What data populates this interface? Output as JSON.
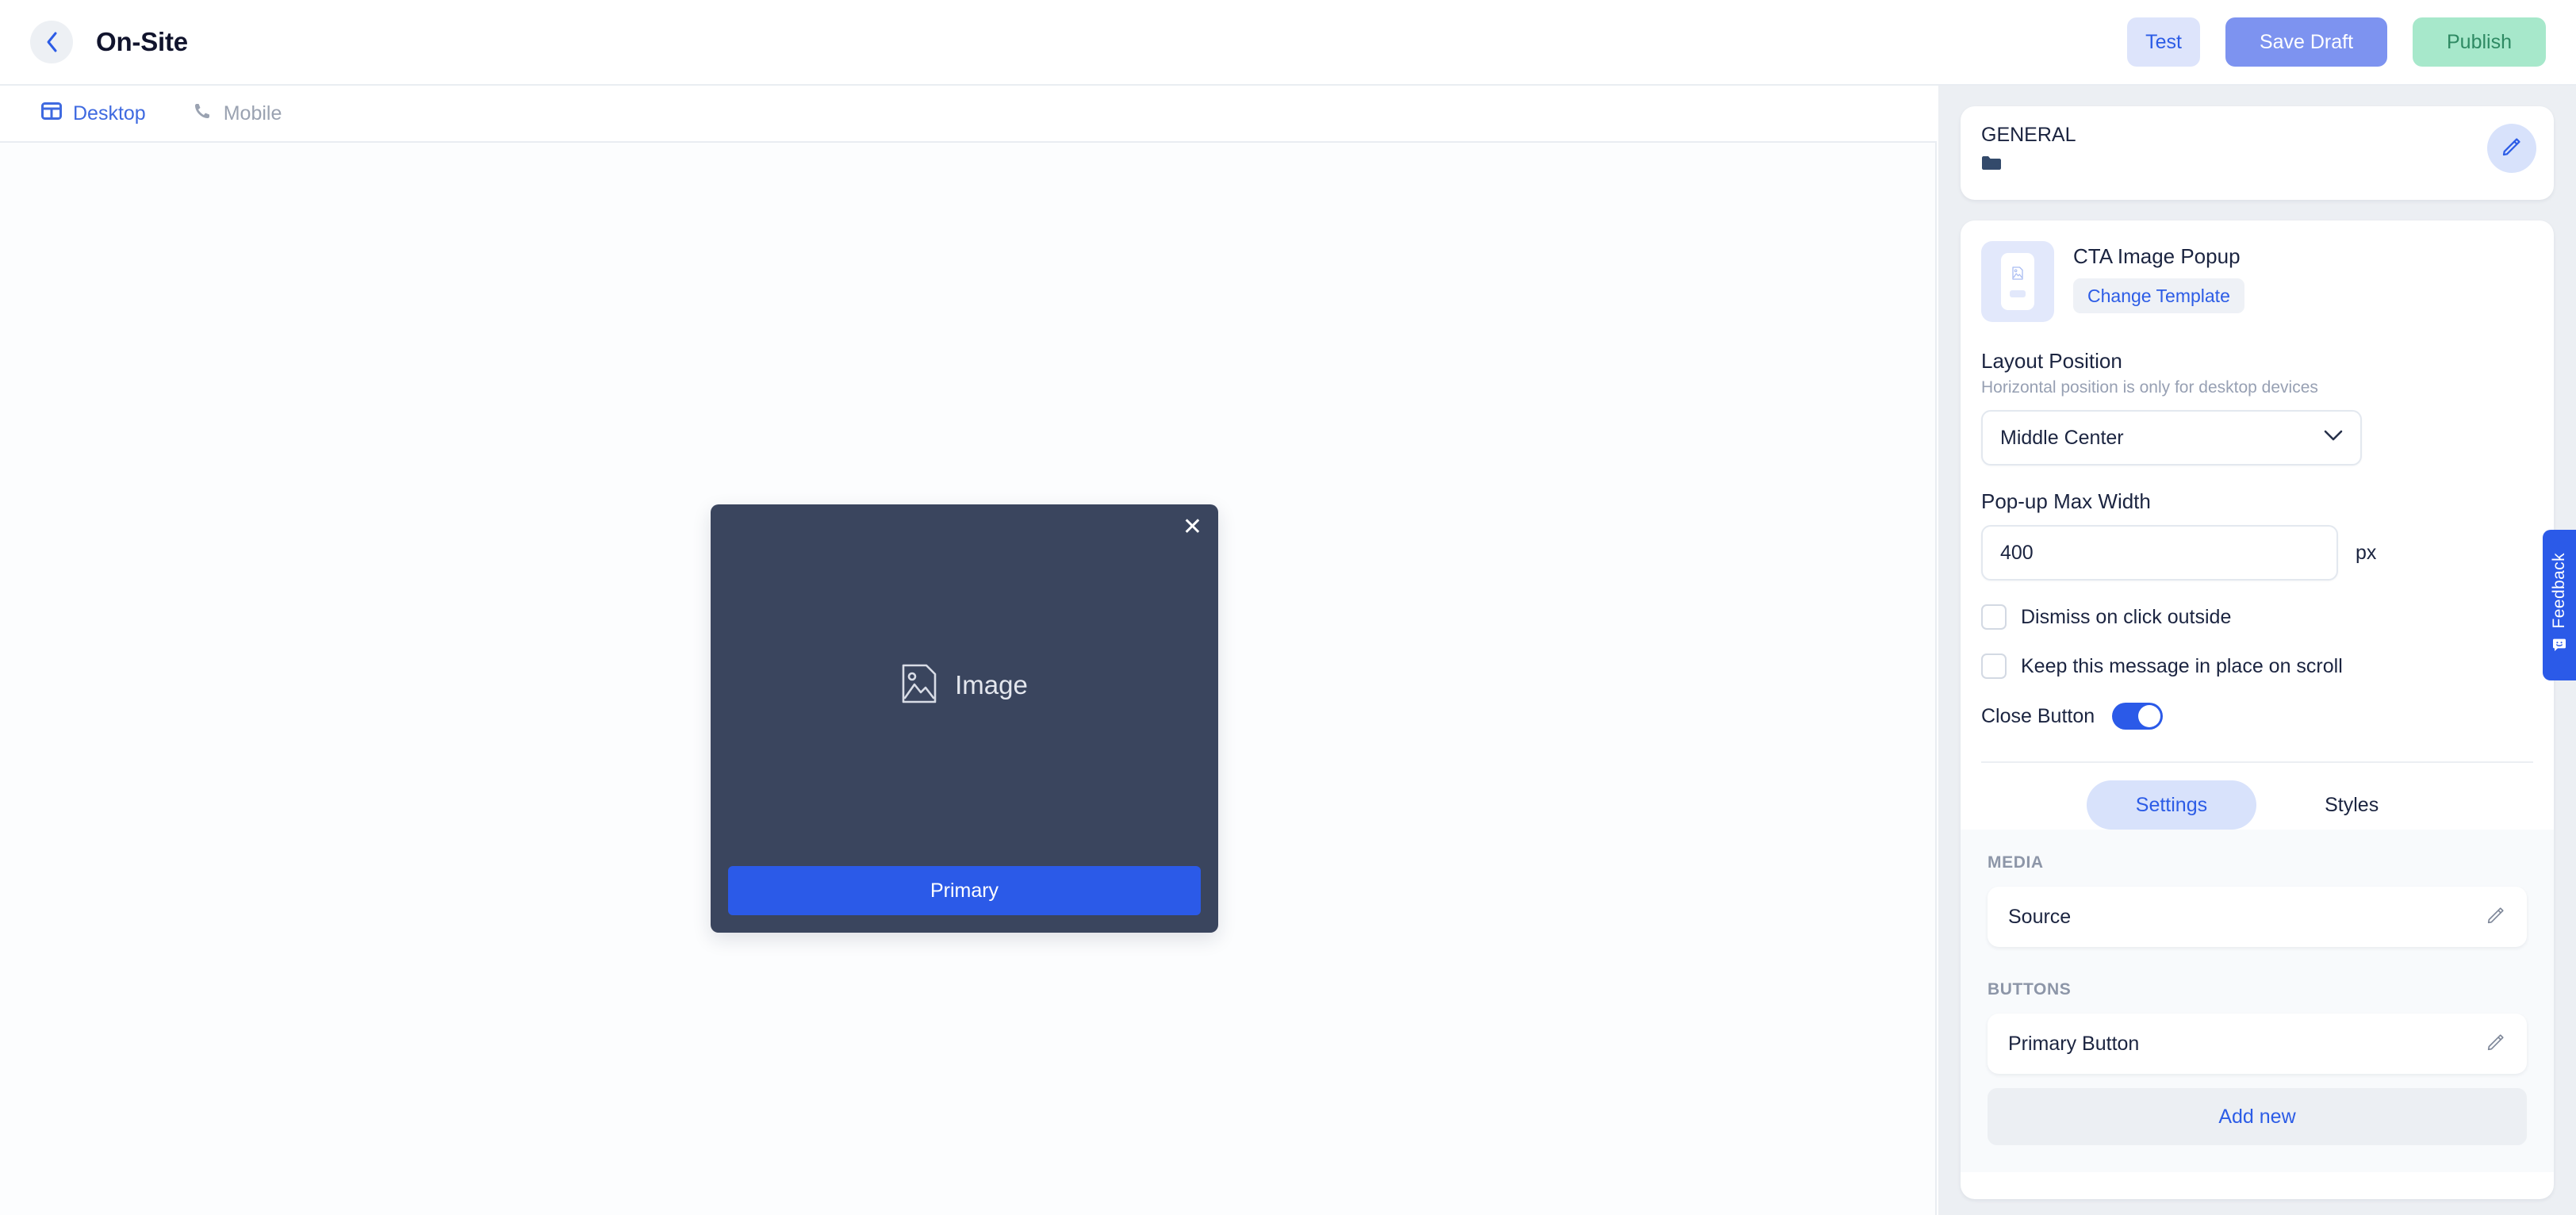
{
  "header": {
    "back_icon": "chevron-left-icon",
    "title": "On-Site",
    "test_label": "Test",
    "save_draft_label": "Save Draft",
    "publish_label": "Publish",
    "accent_blue": "#2c5ce6",
    "save_bg": "#7d93f0",
    "publish_bg": "#a7e8cb"
  },
  "device_tabs": [
    {
      "label": "Desktop",
      "icon": "desktop-icon",
      "active": true
    },
    {
      "label": "Mobile",
      "icon": "phone-icon",
      "active": false
    }
  ],
  "canvas": {
    "popup": {
      "close_icon": "close-icon",
      "image_icon": "image-placeholder-icon",
      "image_label": "Image",
      "primary_button_label": "Primary",
      "background_color": "#3a455e",
      "primary_button_color": "#2b5ae8"
    }
  },
  "panel": {
    "general": {
      "title": "GENERAL",
      "folder_icon": "folder-icon",
      "edit_icon": "pencil-icon"
    },
    "template": {
      "name": "CTA Image Popup",
      "change_label": "Change Template",
      "thumb_icon": "popup-template-thumbnail"
    },
    "layout_position": {
      "label": "Layout Position",
      "hint": "Horizontal position is only for desktop devices",
      "value": "Middle Center",
      "chevron_icon": "chevron-down-icon"
    },
    "max_width": {
      "label": "Pop-up Max Width",
      "value": "400",
      "unit": "px"
    },
    "checkboxes": [
      {
        "label": "Dismiss on click outside",
        "checked": false
      },
      {
        "label": "Keep this message in place on scroll",
        "checked": false
      }
    ],
    "close_button": {
      "label": "Close Button",
      "enabled": true,
      "toggle_color": "#2b5ae8"
    },
    "tabs": [
      {
        "label": "Settings",
        "active": true
      },
      {
        "label": "Styles",
        "active": false
      }
    ],
    "media": {
      "section_title": "MEDIA",
      "items": [
        {
          "label": "Source",
          "edit_icon": "pencil-icon"
        }
      ]
    },
    "buttons": {
      "section_title": "BUTTONS",
      "items": [
        {
          "label": "Primary Button",
          "edit_icon": "pencil-icon"
        }
      ],
      "add_new_label": "Add new"
    }
  },
  "feedback": {
    "label": "Feedback",
    "icon": "feedback-smiley-icon",
    "color": "#2b5ae8"
  }
}
